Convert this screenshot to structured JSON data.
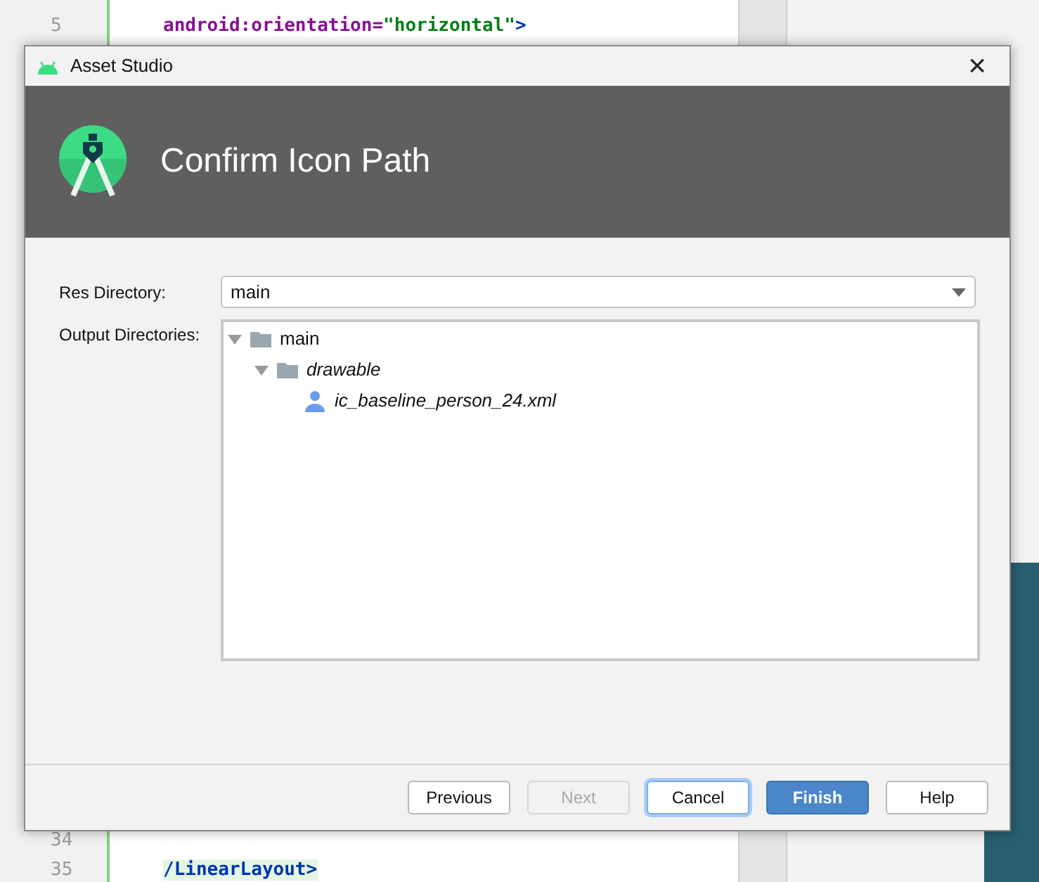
{
  "editor": {
    "top_lines": [
      {
        "number": "5",
        "parts": [
          {
            "kind": "attr",
            "text": "android:orientation="
          },
          {
            "kind": "value",
            "text": "\"horizontal\""
          },
          {
            "kind": "tag",
            "text": ">"
          }
        ]
      }
    ],
    "bottom_lines": [
      {
        "number": "34"
      },
      {
        "number": "35",
        "parts": [
          {
            "kind": "tag",
            "text": "/LinearLayout>"
          }
        ]
      }
    ]
  },
  "dialog": {
    "title": "Asset Studio",
    "close": "×",
    "header": "Confirm Icon Path",
    "res_directory": {
      "label": "Res Directory:",
      "value": "main"
    },
    "output": {
      "label": "Output Directories:",
      "tree": [
        {
          "label": "main",
          "kind": "folder",
          "expanded": true,
          "italic": false,
          "children": [
            {
              "label": "drawable",
              "kind": "folder",
              "expanded": true,
              "italic": true,
              "children": [
                {
                  "label": "ic_baseline_person_24.xml",
                  "kind": "person",
                  "italic": true
                }
              ]
            }
          ]
        }
      ]
    },
    "buttons": [
      {
        "label": "Previous",
        "kind": "normal",
        "disabled": false
      },
      {
        "label": "Next",
        "kind": "normal",
        "disabled": true
      },
      {
        "label": "Cancel",
        "kind": "focused",
        "disabled": false
      },
      {
        "label": "Finish",
        "kind": "primary",
        "disabled": false
      },
      {
        "label": "Help",
        "kind": "normal",
        "disabled": false
      }
    ]
  }
}
